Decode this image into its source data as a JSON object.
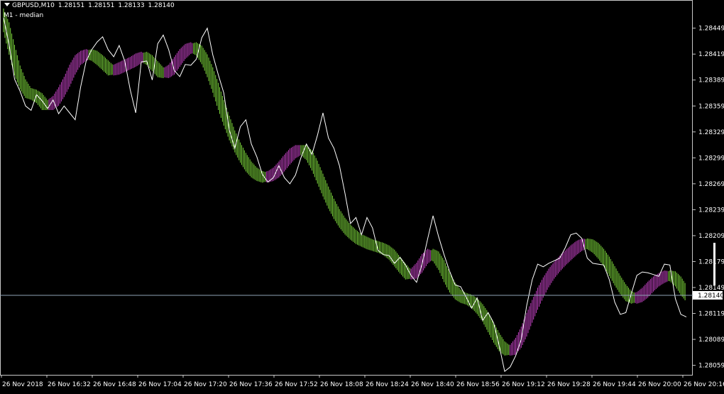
{
  "header": {
    "symbol": "GBPUSD,M10",
    "open": "1.28151",
    "high": "1.28151",
    "low": "1.28133",
    "close": "1.28140",
    "indicator": "M1 - median"
  },
  "colors": {
    "background": "#000000",
    "frame": "#c8c8c8",
    "text": "#ffffff",
    "price_line": "#ffffff",
    "bull": "#7cd63a",
    "bear": "#c442c4",
    "current_price_line": "#8fa3b6",
    "price_tag_bg": "#ffffff",
    "price_tag_text": "#000000"
  },
  "chart_data": {
    "type": "line",
    "ylim": [
      1.28048,
      1.28475
    ],
    "grid": false,
    "y_ticks": [
      1.28449,
      1.28419,
      1.28389,
      1.28359,
      1.28329,
      1.28299,
      1.28269,
      1.28239,
      1.28209,
      1.28179,
      1.28149,
      1.28119,
      1.28089,
      1.28059
    ],
    "y_tick_labels": [
      "1.28449",
      "1.28419",
      "1.28389",
      "1.28359",
      "1.28329",
      "1.28299",
      "1.28269",
      "1.28239",
      "1.28209",
      "1.28179",
      "1.28149",
      "1.28119",
      "1.28089",
      "1.28059"
    ],
    "x_tick_labels": [
      "26 Nov 2018",
      "26 Nov 16:32",
      "26 Nov 16:48",
      "26 Nov 17:04",
      "26 Nov 17:20",
      "26 Nov 17:36",
      "26 Nov 17:52",
      "26 Nov 18:08",
      "26 Nov 18:24",
      "26 Nov 18:40",
      "26 Nov 18:56",
      "26 Nov 19:12",
      "26 Nov 19:28",
      "26 Nov 19:44",
      "26 Nov 20:00",
      "26 Nov 20:16"
    ],
    "current_price": 1.2814,
    "current_price_label": "1.28140",
    "series": [
      {
        "values": [
          1.28461,
          1.2843,
          1.2839,
          1.28376,
          1.28359,
          1.28354,
          1.28372,
          1.28365,
          1.28356,
          1.28366,
          1.2835,
          1.28359,
          1.28351,
          1.28343,
          1.28381,
          1.28411,
          1.28424,
          1.28433,
          1.28439,
          1.28424,
          1.28416,
          1.28429,
          1.28411,
          1.28378,
          1.28351,
          1.2841,
          1.28411,
          1.28389,
          1.28431,
          1.28441,
          1.28424,
          1.284,
          1.28393,
          1.28407,
          1.28406,
          1.28413,
          1.28438,
          1.28449,
          1.28418,
          1.28395,
          1.28374,
          1.28331,
          1.2831,
          1.28335,
          1.28343,
          1.28315,
          1.283,
          1.2828,
          1.28271,
          1.28276,
          1.2829,
          1.28276,
          1.28269,
          1.28279,
          1.28299,
          1.28315,
          1.28303,
          1.28325,
          1.28351,
          1.28322,
          1.2831,
          1.2829,
          1.28258,
          1.28223,
          1.2823,
          1.2821,
          1.2823,
          1.28218,
          1.28192,
          1.28187,
          1.28186,
          1.28177,
          1.28184,
          1.28175,
          1.28163,
          1.28155,
          1.28176,
          1.28205,
          1.28232,
          1.28208,
          1.28187,
          1.28168,
          1.28152,
          1.2815,
          1.28138,
          1.28125,
          1.28137,
          1.28111,
          1.2812,
          1.28108,
          1.28082,
          1.28052,
          1.28057,
          1.2807,
          1.28089,
          1.28128,
          1.28158,
          1.28176,
          1.28173,
          1.28177,
          1.2818,
          1.28183,
          1.28195,
          1.2821,
          1.28212,
          1.28206,
          1.28183,
          1.28177,
          1.28176,
          1.28175,
          1.28158,
          1.28132,
          1.28118,
          1.2812,
          1.28142,
          1.28163,
          1.28167,
          1.28166,
          1.28164,
          1.28162,
          1.28176,
          1.28175,
          1.28136,
          1.28118,
          1.28115
        ]
      },
      {
        "values": [
          1.28466,
          1.2845,
          1.28424,
          1.284,
          1.28384,
          1.28374,
          1.28372,
          1.28368,
          1.2836,
          1.2836,
          1.28365,
          1.28375,
          1.28387,
          1.28401,
          1.28412,
          1.28417,
          1.28419,
          1.28417,
          1.28412,
          1.28406,
          1.284,
          1.28401,
          1.28404,
          1.28407,
          1.2841,
          1.28414,
          1.28416,
          1.28412,
          1.28405,
          1.28398,
          1.28397,
          1.28401,
          1.2841,
          1.28419,
          1.28425,
          1.28427,
          1.28423,
          1.28413,
          1.28398,
          1.2838,
          1.2836,
          1.28342,
          1.28325,
          1.28311,
          1.28299,
          1.28289,
          1.28282,
          1.28278,
          1.28276,
          1.28278,
          1.28282,
          1.28289,
          1.28297,
          1.28304,
          1.28308,
          1.28308,
          1.28302,
          1.2829,
          1.28275,
          1.2826,
          1.28246,
          1.28234,
          1.28224,
          1.28216,
          1.2821,
          1.28205,
          1.28202,
          1.28199,
          1.28197,
          1.28195,
          1.28192,
          1.28187,
          1.28179,
          1.28171,
          1.28164,
          1.28165,
          1.28172,
          1.28182,
          1.28188,
          1.28185,
          1.28175,
          1.28161,
          1.28149,
          1.28141,
          1.28137,
          1.28135,
          1.28131,
          1.28124,
          1.28115,
          1.28103,
          1.28091,
          1.28081,
          1.28076,
          1.28077,
          1.28085,
          1.28098,
          1.28114,
          1.28129,
          1.28143,
          1.28155,
          1.28165,
          1.28173,
          1.2818,
          1.28186,
          1.28192,
          1.28197,
          1.282,
          1.28199,
          1.28195,
          1.28188,
          1.28179,
          1.28168,
          1.28157,
          1.28147,
          1.28139,
          1.28136,
          1.28138,
          1.28143,
          1.2815,
          1.28156,
          1.2816,
          1.28163,
          1.28162,
          1.28156,
          1.28146
        ]
      },
      {
        "values": [
          1.2845,
          1.28424,
          1.284,
          1.28384,
          1.28374,
          1.28372,
          1.28368,
          1.2836,
          1.2836,
          1.28365,
          1.28375,
          1.28387,
          1.28401,
          1.28412,
          1.28417,
          1.28419,
          1.28417,
          1.28412,
          1.28406,
          1.284,
          1.28401,
          1.28404,
          1.28407,
          1.2841,
          1.28414,
          1.28416,
          1.28412,
          1.28405,
          1.28398,
          1.28397,
          1.28401,
          1.2841,
          1.28419,
          1.28425,
          1.28427,
          1.28423,
          1.28413,
          1.28398,
          1.2838,
          1.2836,
          1.28342,
          1.28325,
          1.28311,
          1.28299,
          1.28289,
          1.28282,
          1.28278,
          1.28276,
          1.28278,
          1.28282,
          1.28289,
          1.28297,
          1.28304,
          1.28308,
          1.28308,
          1.28302,
          1.2829,
          1.28275,
          1.2826,
          1.28246,
          1.28234,
          1.28224,
          1.28216,
          1.2821,
          1.28205,
          1.28202,
          1.28199,
          1.28197,
          1.28195,
          1.28192,
          1.28187,
          1.28179,
          1.28171,
          1.28164,
          1.28165,
          1.28172,
          1.28182,
          1.28188,
          1.28185,
          1.28175,
          1.28161,
          1.28149,
          1.28141,
          1.28137,
          1.28135,
          1.28131,
          1.28124,
          1.28115,
          1.28103,
          1.28091,
          1.28081,
          1.28076,
          1.28077,
          1.28085,
          1.28098,
          1.28114,
          1.28129,
          1.28143,
          1.28155,
          1.28165,
          1.28173,
          1.2818,
          1.28186,
          1.28192,
          1.28197,
          1.282,
          1.28199,
          1.28195,
          1.28188,
          1.28179,
          1.28168,
          1.28157,
          1.28147,
          1.28139,
          1.28136,
          1.28138,
          1.28143,
          1.2815,
          1.28156,
          1.2816,
          1.28163,
          1.28162,
          1.28156,
          1.28146,
          1.28138
        ]
      }
    ]
  }
}
